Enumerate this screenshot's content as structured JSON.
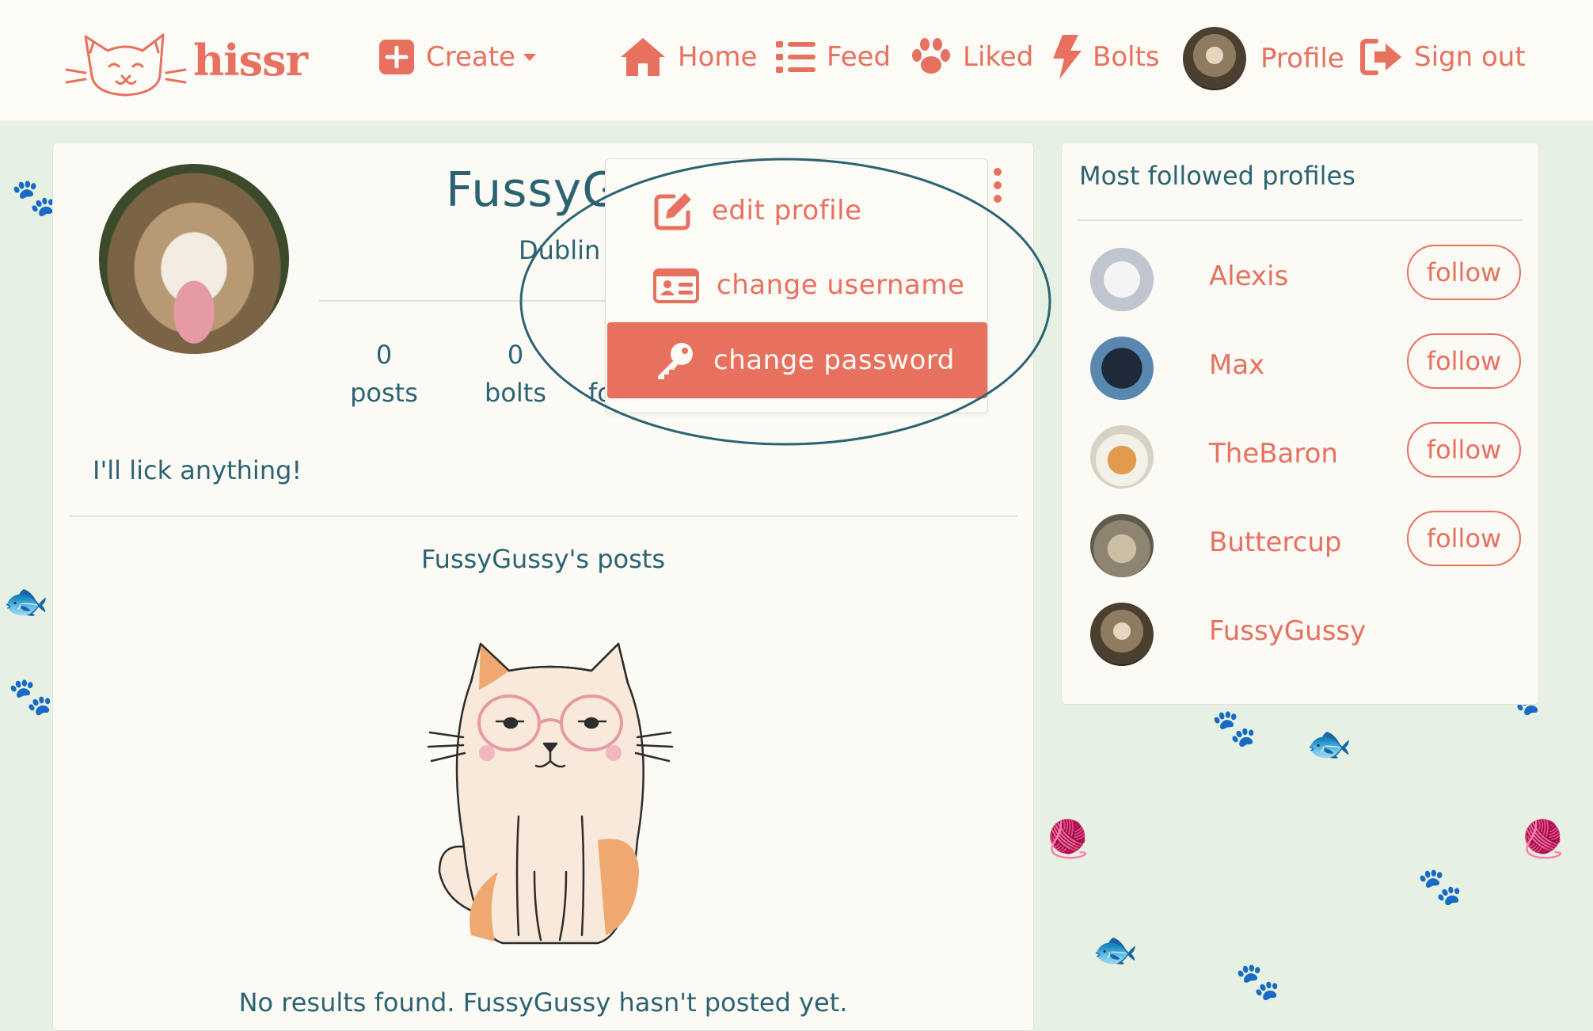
{
  "navbar": {
    "brand": "hissr",
    "create": "Create",
    "home": "Home",
    "feed": "Feed",
    "liked": "Liked",
    "bolts": "Bolts",
    "profile": "Profile",
    "signout": "Sign out"
  },
  "profile": {
    "username": "FussyG",
    "location": "Dublin",
    "stats": [
      {
        "value": "0",
        "label": "posts"
      },
      {
        "value": "0",
        "label": "bolts"
      },
      {
        "value": "",
        "label": "fo"
      }
    ],
    "bio": "I'll lick anything!",
    "posts_title": "FussyGussy's posts",
    "no_results": "No results found. FussyGussy hasn't posted yet."
  },
  "dropdown": {
    "items": [
      {
        "label": "edit profile",
        "icon": "edit-icon"
      },
      {
        "label": "change username",
        "icon": "id-card-icon"
      },
      {
        "label": "change password",
        "icon": "key-icon"
      }
    ]
  },
  "sidebar": {
    "title": "Most followed profiles",
    "profiles": [
      {
        "name": "Alexis",
        "button": "follow"
      },
      {
        "name": "Max",
        "button": "follow"
      },
      {
        "name": "TheBaron",
        "button": "follow"
      },
      {
        "name": "Buttercup",
        "button": "follow"
      },
      {
        "name": "FussyGussy",
        "button": ""
      }
    ]
  },
  "colors": {
    "accent": "#e8705f",
    "text": "#2b6372",
    "background": "#e6f1e3",
    "card": "#fcfaf5"
  }
}
